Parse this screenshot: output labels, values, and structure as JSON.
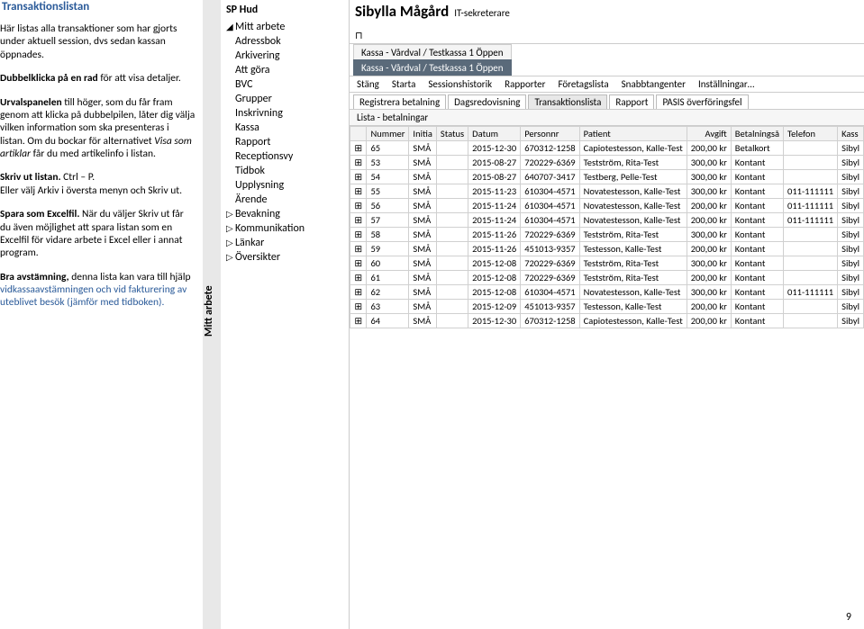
{
  "doc": {
    "title": "Transaktionslistan",
    "p1": "Här listas alla transaktioner som har gjorts under aktuell session, dvs sedan kassan öppnades.",
    "p2a": "Dubbelklicka på en rad",
    "p2b": " för att visa detaljer.",
    "p3a": "Urvalspanelen",
    "p3b": " till höger, som du får fram genom att klicka på dubbelpilen, låter dig välja vilken information som ska presenteras i listan. Om du bockar för alternativet ",
    "p3c": "Visa som artiklar",
    "p3d": " får du med artikelinfo i listan.",
    "p4a": "Skriv ut listan.",
    "p4b": " Ctrl – P.\nEller välj Arkiv i översta menyn och Skriv ut.",
    "p5a": "Spara som Excelfil.",
    "p5b": " När du väljer Skriv ut får du även möjlighet att spara listan som en Excelfil för vidare arbete i Excel eller i annat program.",
    "p6a": "Bra avstämning,",
    "p6b": " denna lista kan vara till hjälp ",
    "p6c": "vidkassaavstämningen och vid fakturering av uteblivet besök (jämför med tidboken).",
    "pagenum": "9"
  },
  "app": {
    "vtab": "Mitt arbete",
    "unit": "SP Hud",
    "user": "Sibylla Mågård",
    "role": "IT-sekreterare",
    "nav": {
      "title": "Mitt arbete",
      "items": [
        "Adressbok",
        "Arkivering",
        "Att göra",
        "BVC",
        "Grupper",
        "Inskrivning",
        "Kassa",
        "Rapport",
        "Receptionsvy",
        "Tidbok",
        "Upplysning",
        "Ärende"
      ],
      "sections": [
        "Bevakning",
        "Kommunikation",
        "Länkar",
        "Översikter"
      ]
    },
    "tabs": [
      "Kassa - Vårdval / Testkassa 1 Öppen",
      "Kassa - Vårdval / Testkassa 1 Öppen"
    ],
    "menu": [
      "Stäng",
      "Starta",
      "Sessionshistorik",
      "Rapporter",
      "Företagslista",
      "Snabbtangenter",
      "Inställningar…"
    ],
    "subtabs": [
      "Registrera betalning",
      "Dagsredovisning",
      "Transaktionslista",
      "Rapport",
      "PASIS överföringsfel"
    ],
    "listLabel": "Lista - betalningar",
    "cols": [
      "",
      "Nummer",
      "Initia",
      "Status",
      "Datum",
      "Personnr",
      "Patient",
      "Avgift",
      "Betalningså",
      "Telefon",
      "Kass"
    ],
    "rows": [
      {
        "n": "65",
        "i": "SMÅ",
        "s": "",
        "d": "2015-12-30",
        "p": "670312-1258",
        "pt": "Capiotestesson, Kalle-Test",
        "a": "200,00 kr",
        "b": "Betalkort",
        "t": "",
        "k": "Sibyl"
      },
      {
        "n": "53",
        "i": "SMÅ",
        "s": "",
        "d": "2015-08-27",
        "p": "720229-6369",
        "pt": "Testström, Rita-Test",
        "a": "300,00 kr",
        "b": "Kontant",
        "t": "",
        "k": "Sibyl"
      },
      {
        "n": "54",
        "i": "SMÅ",
        "s": "",
        "d": "2015-08-27",
        "p": "640707-3417",
        "pt": "Testberg, Pelle-Test",
        "a": "300,00 kr",
        "b": "Kontant",
        "t": "",
        "k": "Sibyl"
      },
      {
        "n": "55",
        "i": "SMÅ",
        "s": "",
        "d": "2015-11-23",
        "p": "610304-4571",
        "pt": "Novatestesson, Kalle-Test",
        "a": "300,00 kr",
        "b": "Kontant",
        "t": "011-111111",
        "k": "Sibyl"
      },
      {
        "n": "56",
        "i": "SMÅ",
        "s": "",
        "d": "2015-11-24",
        "p": "610304-4571",
        "pt": "Novatestesson, Kalle-Test",
        "a": "200,00 kr",
        "b": "Kontant",
        "t": "011-111111",
        "k": "Sibyl"
      },
      {
        "n": "57",
        "i": "SMÅ",
        "s": "",
        "d": "2015-11-24",
        "p": "610304-4571",
        "pt": "Novatestesson, Kalle-Test",
        "a": "200,00 kr",
        "b": "Kontant",
        "t": "011-111111",
        "k": "Sibyl"
      },
      {
        "n": "58",
        "i": "SMÅ",
        "s": "",
        "d": "2015-11-26",
        "p": "720229-6369",
        "pt": "Testström, Rita-Test",
        "a": "300,00 kr",
        "b": "Kontant",
        "t": "",
        "k": "Sibyl"
      },
      {
        "n": "59",
        "i": "SMÅ",
        "s": "",
        "d": "2015-11-26",
        "p": "451013-9357",
        "pt": "Testesson, Kalle-Test",
        "a": "200,00 kr",
        "b": "Kontant",
        "t": "",
        "k": "Sibyl"
      },
      {
        "n": "60",
        "i": "SMÅ",
        "s": "",
        "d": "2015-12-08",
        "p": "720229-6369",
        "pt": "Testström, Rita-Test",
        "a": "300,00 kr",
        "b": "Kontant",
        "t": "",
        "k": "Sibyl"
      },
      {
        "n": "61",
        "i": "SMÅ",
        "s": "",
        "d": "2015-12-08",
        "p": "720229-6369",
        "pt": "Testström, Rita-Test",
        "a": "200,00 kr",
        "b": "Kontant",
        "t": "",
        "k": "Sibyl"
      },
      {
        "n": "62",
        "i": "SMÅ",
        "s": "",
        "d": "2015-12-08",
        "p": "610304-4571",
        "pt": "Novatestesson, Kalle-Test",
        "a": "300,00 kr",
        "b": "Kontant",
        "t": "011-111111",
        "k": "Sibyl"
      },
      {
        "n": "63",
        "i": "SMÅ",
        "s": "",
        "d": "2015-12-09",
        "p": "451013-9357",
        "pt": "Testesson, Kalle-Test",
        "a": "200,00 kr",
        "b": "Kontant",
        "t": "",
        "k": "Sibyl"
      },
      {
        "n": "64",
        "i": "SMÅ",
        "s": "",
        "d": "2015-12-30",
        "p": "670312-1258",
        "pt": "Capiotestesson, Kalle-Test",
        "a": "200,00 kr",
        "b": "Kontant",
        "t": "",
        "k": "Sibyl"
      }
    ]
  }
}
